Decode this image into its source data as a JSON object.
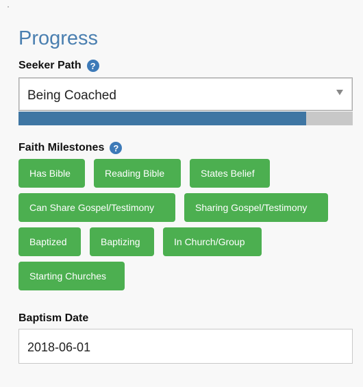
{
  "section_title": "Progress",
  "seeker_path": {
    "label": "Seeker Path",
    "selected": "Being Coached",
    "progress_fraction": 0.86
  },
  "faith_milestones": {
    "label": "Faith Milestones",
    "items": [
      "Has Bible",
      "Reading Bible",
      "States Belief",
      "Can Share Gospel/Testimony",
      "Sharing Gospel/Testimony",
      "Baptized",
      "Baptizing",
      "In Church/Group",
      "Starting Churches"
    ]
  },
  "baptism_date": {
    "label": "Baptism Date",
    "value": "2018-06-01"
  },
  "help_glyph": "?",
  "colors": {
    "title": "#4a7fb0",
    "milestone_button": "#4caf50",
    "progress_fill": "#3f76a3",
    "help_icon": "#3d7ab8"
  },
  "icons": [
    "question-circle-icon",
    "dropdown-caret-icon"
  ]
}
